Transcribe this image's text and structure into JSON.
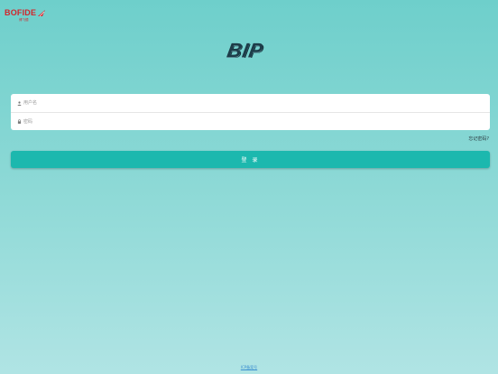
{
  "brand": {
    "name": "BOFIDE",
    "sub": "博飞德",
    "color": "#d1262c"
  },
  "hero": {
    "logo_text": "BIP"
  },
  "form": {
    "username_placeholder": "用户名",
    "password_placeholder": "密码",
    "username_icon": "user-icon",
    "password_icon": "lock-icon"
  },
  "links": {
    "forgot": "忘记密码?",
    "footer": "ICP备案号"
  },
  "login": {
    "label": "登 录",
    "color": "#1cb8ae"
  }
}
